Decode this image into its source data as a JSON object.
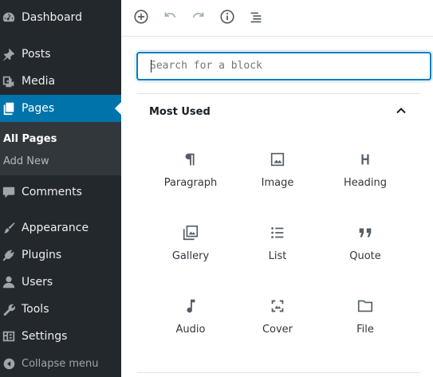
{
  "sidebar": {
    "items": [
      {
        "label": "Dashboard",
        "icon": "dashboard-icon"
      },
      {
        "label": "Posts",
        "icon": "pushpin-icon"
      },
      {
        "label": "Media",
        "icon": "media-icon"
      },
      {
        "label": "Pages",
        "icon": "pages-icon",
        "current": true
      },
      {
        "label": "Comments",
        "icon": "comment-icon"
      },
      {
        "label": "Appearance",
        "icon": "brush-icon"
      },
      {
        "label": "Plugins",
        "icon": "plugin-icon"
      },
      {
        "label": "Users",
        "icon": "user-icon"
      },
      {
        "label": "Tools",
        "icon": "wrench-icon"
      },
      {
        "label": "Settings",
        "icon": "settings-icon"
      }
    ],
    "submenu": [
      {
        "label": "All Pages",
        "active": true
      },
      {
        "label": "Add New"
      }
    ],
    "collapse_label": "Collapse menu",
    "colors": {
      "background": "#23282d",
      "current": "#0073aa",
      "submenu": "#32373c"
    }
  },
  "toolbar": {
    "buttons": [
      "add-block-icon",
      "undo-icon",
      "redo-icon",
      "info-icon",
      "outline-icon"
    ]
  },
  "inserter": {
    "search_placeholder": "Search for a block",
    "section_title": "Most Used",
    "blocks": [
      {
        "label": "Paragraph",
        "icon": "paragraph-icon"
      },
      {
        "label": "Image",
        "icon": "image-icon"
      },
      {
        "label": "Heading",
        "icon": "heading-icon"
      },
      {
        "label": "Gallery",
        "icon": "gallery-icon"
      },
      {
        "label": "List",
        "icon": "list-icon"
      },
      {
        "label": "Quote",
        "icon": "quote-icon"
      },
      {
        "label": "Audio",
        "icon": "audio-icon"
      },
      {
        "label": "Cover",
        "icon": "cover-icon"
      },
      {
        "label": "File",
        "icon": "file-icon"
      }
    ],
    "accent": "#007cba"
  }
}
